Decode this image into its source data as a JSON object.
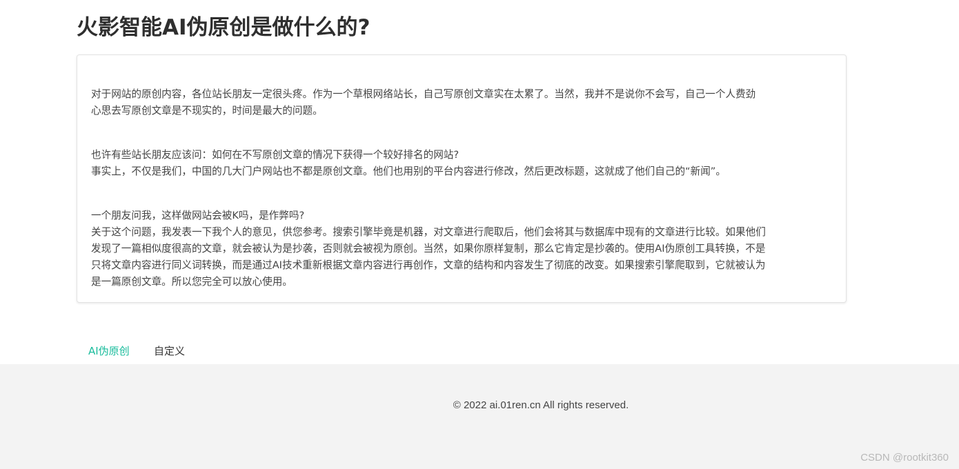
{
  "article": {
    "title": "火影智能AI伪原创是做什么的?",
    "paragraphs": [
      [
        "    对于网站的原创内容，各位站长朋友一定很头疼。作为一个草根网络站长，自己写原创文章实在太累了。当然，我并不是说你不会写，自己一个人费劲",
        "心思去写原创文章是不现实的，时间是最大的问题。"
      ],
      [
        "也许有些站长朋友应该问：如何在不写原创文章的情况下获得一个较好排名的网站?",
        "事实上，不仅是我们，中国的几大门户网站也不都是原创文章。他们也用别的平台内容进行修改，然后更改标题，这就成了他们自己的“新闻”。"
      ],
      [
        "一个朋友问我，这样做网站会被K吗，是作弊吗?",
        "关于这个问题，我发表一下我个人的意见，供您参考。搜索引擎毕竟是机器，对文章进行爬取后，他们会将其与数据库中现有的文章进行比较。如果他们",
        "发现了一篇相似度很高的文章，就会被认为是抄袭，否则就会被视为原创。当然，如果你原样复制，那么它肯定是抄袭的。使用AI伪原创工具转换，不是",
        "只将文章内容进行同义词转换，而是通过AI技术重新根据文章内容进行再创作，文章的结构和内容发生了彻底的改变。如果搜索引擎爬取到，它就被认为",
        "是一篇原创文章。所以您完全可以放心使用。"
      ]
    ]
  },
  "tabs": [
    {
      "label": "AI伪原创",
      "active": true
    },
    {
      "label": "自定义",
      "active": false
    }
  ],
  "footer": {
    "copyright": "© 2022 ai.01ren.cn All rights reserved.",
    "watermark": "CSDN @rootkit360"
  },
  "colors": {
    "accent": "#1abc9c",
    "footer_bg": "#f3f3f3",
    "text": "#444444"
  }
}
